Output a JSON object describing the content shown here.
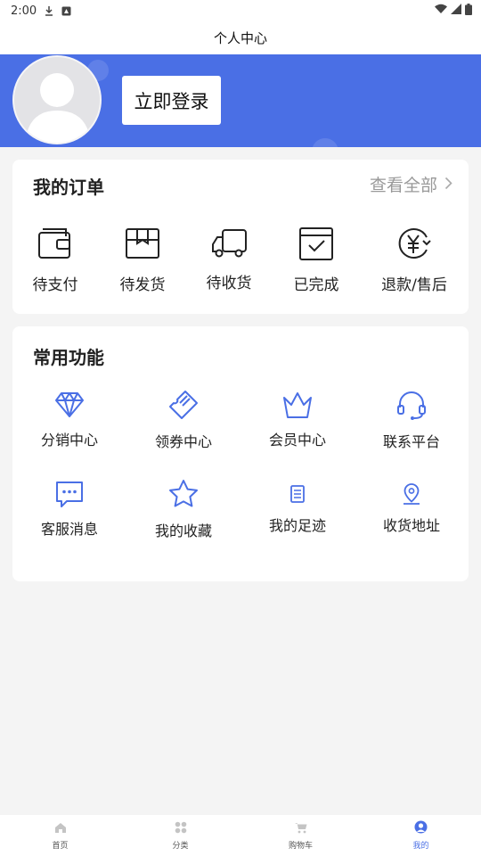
{
  "status_bar": {
    "time": "2:00"
  },
  "title": "个人中心",
  "profile": {
    "login_label": "立即登录"
  },
  "orders": {
    "title": "我的订单",
    "view_all": "查看全部",
    "items": [
      {
        "label": "待支付",
        "icon": "wallet-icon"
      },
      {
        "label": "待发货",
        "icon": "box-icon"
      },
      {
        "label": "待收货",
        "icon": "truck-icon"
      },
      {
        "label": "已完成",
        "icon": "calendar-check-icon"
      },
      {
        "label": "退款/售后",
        "icon": "yen-refund-icon"
      }
    ]
  },
  "functions": {
    "title": "常用功能",
    "items": [
      {
        "label": "分销中心",
        "icon": "diamond-icon"
      },
      {
        "label": "领券中心",
        "icon": "coupon-icon"
      },
      {
        "label": "会员中心",
        "icon": "crown-icon"
      },
      {
        "label": "联系平台",
        "icon": "headset-icon"
      },
      {
        "label": "客服消息",
        "icon": "chat-icon"
      },
      {
        "label": "我的收藏",
        "icon": "star-icon"
      },
      {
        "label": "我的足迹",
        "icon": "document-icon"
      },
      {
        "label": "收货地址",
        "icon": "location-icon"
      }
    ]
  },
  "tabbar": {
    "items": [
      {
        "label": "首页",
        "icon": "home-icon"
      },
      {
        "label": "分类",
        "icon": "category-icon"
      },
      {
        "label": "购物车",
        "icon": "cart-icon"
      },
      {
        "label": "我的",
        "icon": "user-icon",
        "active": true
      }
    ]
  },
  "colors": {
    "accent": "#4a6fe5",
    "background": "#f4f4f4"
  }
}
